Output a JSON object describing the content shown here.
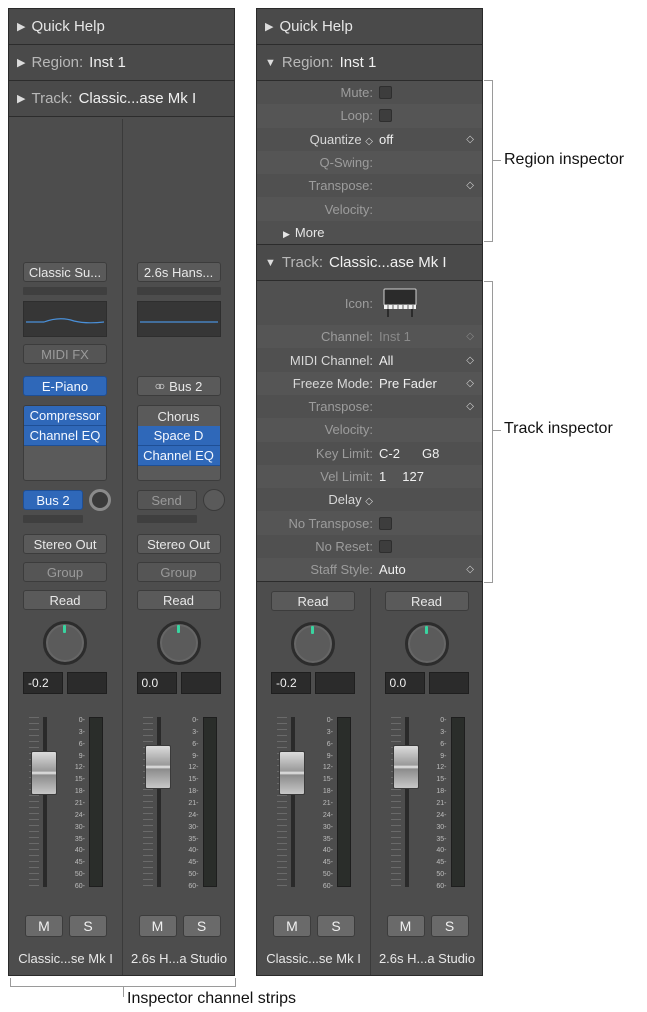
{
  "left_panel": {
    "quick_help": "Quick Help",
    "region_label": "Region:",
    "region_value": "Inst 1",
    "track_label": "Track:",
    "track_value": "Classic...ase Mk I",
    "strips": [
      {
        "setting": "Classic Su...",
        "midi_fx": "MIDI FX",
        "instrument": "E-Piano",
        "effects": [
          "Compressor",
          "Channel EQ"
        ],
        "send": "Bus 2",
        "output": "Stereo Out",
        "group": "Group",
        "automation": "Read",
        "volume": "-0.2",
        "mute": "M",
        "solo": "S",
        "name": "Classic...se Mk I"
      },
      {
        "setting": "2.6s Hans...",
        "input": "Bus 2",
        "effects": [
          "Chorus",
          "Space D",
          "Channel EQ"
        ],
        "send": "Send",
        "output": "Stereo Out",
        "group": "Group",
        "automation": "Read",
        "volume": "0.0",
        "mute": "M",
        "solo": "S",
        "name": "2.6s H...a Studio"
      }
    ]
  },
  "right_panel": {
    "quick_help": "Quick Help",
    "region_label": "Region:",
    "region_value": "Inst 1",
    "region_rows": [
      {
        "label": "Mute:",
        "value": ""
      },
      {
        "label": "Loop:",
        "value": ""
      },
      {
        "label": "Quantize",
        "value": "off"
      },
      {
        "label": "Q-Swing:",
        "value": ""
      },
      {
        "label": "Transpose:",
        "value": ""
      },
      {
        "label": "Velocity:",
        "value": ""
      }
    ],
    "more_label": "More",
    "track_label": "Track:",
    "track_value": "Classic...ase Mk I",
    "track_rows": [
      {
        "label": "Icon:",
        "value": ""
      },
      {
        "label": "Channel:",
        "value": "Inst 1"
      },
      {
        "label": "MIDI Channel:",
        "value": "All"
      },
      {
        "label": "Freeze Mode:",
        "value": "Pre Fader"
      },
      {
        "label": "Transpose:",
        "value": ""
      },
      {
        "label": "Velocity:",
        "value": ""
      },
      {
        "label": "Key Limit:",
        "value": "C-2",
        "value2": "G8"
      },
      {
        "label": "Vel Limit:",
        "value": "1",
        "value2": "127"
      },
      {
        "label": "Delay",
        "value": ""
      },
      {
        "label": "No Transpose:",
        "value": ""
      },
      {
        "label": "No Reset:",
        "value": ""
      },
      {
        "label": "Staff Style:",
        "value": "Auto"
      }
    ],
    "strips": [
      {
        "automation": "Read",
        "volume": "-0.2",
        "mute": "M",
        "solo": "S",
        "name": "Classic...se Mk I"
      },
      {
        "automation": "Read",
        "volume": "0.0",
        "mute": "M",
        "solo": "S",
        "name": "2.6s H...a Studio"
      }
    ]
  },
  "fader_scale": [
    "0",
    "3",
    "6",
    "9",
    "12",
    "15",
    "18",
    "21",
    "24",
    "30",
    "35",
    "40",
    "45",
    "50",
    "60"
  ],
  "callouts": {
    "region_inspector": "Region inspector",
    "track_inspector": "Track inspector",
    "channel_strips": "Inspector channel strips"
  },
  "colors": {
    "panel": "#4d4d4d",
    "plugin_blue": "#2f68b9",
    "pan_indicator": "#39d4a0"
  }
}
